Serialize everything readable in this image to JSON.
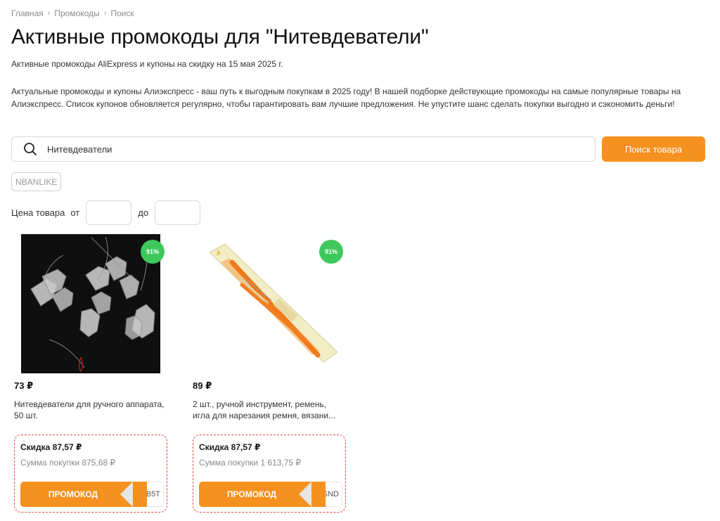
{
  "breadcrumb": {
    "items": [
      "Главная",
      "Промокоды",
      "Поиск"
    ]
  },
  "page": {
    "title": "Активные промокоды для \"Нитевдеватели\"",
    "subtitle": "Активные промокоды AliExpress и купоны на скидку на 15 мая 2025 г.",
    "description": "Актуальные промокоды и купоны Алиэкспресс - ваш путь к выгодным покупкам в 2025 году! В нашей подборке действующие промокоды на самые популярные товары на Алиэкспресс. Список купонов обновляется регулярно, чтобы гарантировать вам лучшие предложения. Не упустите шанс сделать покупки выгодно и сэкономить деньги!"
  },
  "search": {
    "value": "Нитевдеватели",
    "button_label": "Поиск товара"
  },
  "tags": [
    "NBANLIKE"
  ],
  "price_filter": {
    "label": "Цена товара",
    "from_label": "от",
    "to_label": "до",
    "from_value": "",
    "to_value": ""
  },
  "products": [
    {
      "discount_badge": "91%",
      "price": "73 ₽",
      "title": "Нитевдеватели для ручного аппарата, 50 шт.",
      "coupon_discount": "Скидка 87,57 ₽",
      "coupon_min": "Сумма покупки 875,68 ₽",
      "promo_label": "ПРОМОКОД",
      "promo_code": "VUB5T"
    },
    {
      "discount_badge": "91%",
      "price": "89 ₽",
      "title": "2 шт., ручной инструмент, ремень, игла для нарезания ремня, вязани...",
      "coupon_discount": "Скидка 87,57 ₽",
      "coupon_min": "Сумма покупки 1 613,75 ₽",
      "promo_label": "ПРОМОКОД",
      "promo_code": "SYSND"
    }
  ],
  "colors": {
    "accent": "#f5911e",
    "badge": "#3ec85c",
    "coupon_border": "#e24a4a"
  }
}
